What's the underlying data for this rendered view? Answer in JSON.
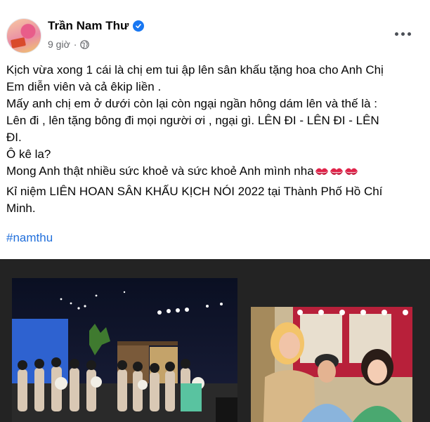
{
  "post": {
    "author": "Trần Nam Thư",
    "time": "9 giờ",
    "lines": [
      "Kịch vừa xong 1 cái là chị em tui ập lên sân khấu tặng hoa cho Anh Chị",
      "Em diễn viên và cả êkip liền .",
      "Mấy anh chị em ở dưới còn lại còn ngại ngần hông dám lên và thế là :",
      "Lên đi , lên tặng bông đi mọi người ơi , ngại gì. LÊN ĐI - LÊN ĐI - LÊN",
      "ĐI.",
      "Ô kê la?",
      "Mong Anh thật nhiều sức khoẻ và sức khoẻ Anh mình nha"
    ],
    "footer_lines": [
      "Kỉ niệm LIÊN HOAN SÂN KHẤU KỊCH NÓI 2022 tại Thành Phố Hồ Chí",
      "Minh."
    ],
    "hashtag": "#namthu"
  },
  "icons": {
    "verified": "verified-badge-icon",
    "audience": "globe-icon",
    "more": "more-options-icon",
    "emoji": "kiss-mark-icon"
  },
  "colors": {
    "link": "#216fdb",
    "verified": "#1877f2",
    "secondary_text": "#65676b",
    "media_bg": "#232323"
  }
}
